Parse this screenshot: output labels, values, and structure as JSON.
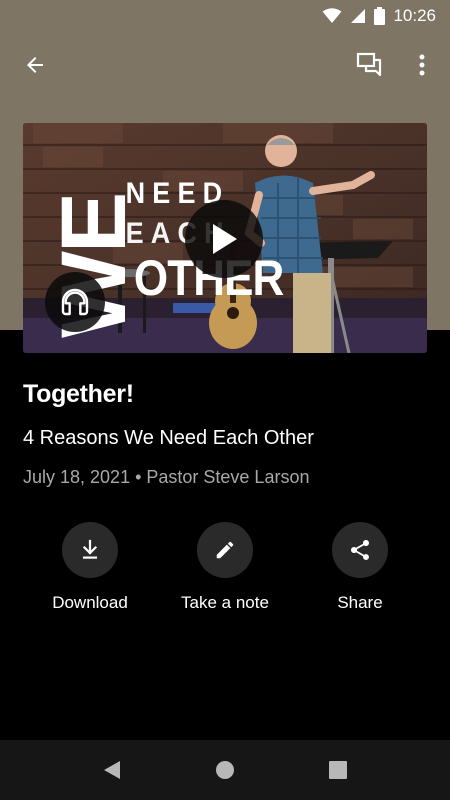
{
  "status_bar": {
    "time": "10:26",
    "icons": [
      "wifi-icon",
      "signal-icon",
      "battery-icon"
    ]
  },
  "toolbar": {
    "back_icon": "arrow-left-icon",
    "chat_icon": "chat-bubbles-icon",
    "more_icon": "more-vertical-icon"
  },
  "artwork": {
    "text_we": "WE",
    "text_need": "NEED",
    "text_each": "EACH",
    "text_other": "OTHER"
  },
  "sermon": {
    "title": "Together!",
    "subtitle": "4 Reasons We Need Each Other",
    "meta": "July 18, 2021 • Pastor Steve Larson"
  },
  "actions": [
    {
      "label": "Download",
      "icon": "download-icon"
    },
    {
      "label": "Take a note",
      "icon": "pencil-icon"
    },
    {
      "label": "Share",
      "icon": "share-icon"
    }
  ],
  "nav_bar": {
    "icons": [
      "back-triangle-icon",
      "home-circle-icon",
      "recents-square-icon"
    ]
  },
  "colors": {
    "header_bg": "#7e7565",
    "page_bg": "#000000",
    "meta_text": "#a8a8a8",
    "action_circle": "#2a2a2a",
    "nav_bar_bg": "#161616"
  }
}
